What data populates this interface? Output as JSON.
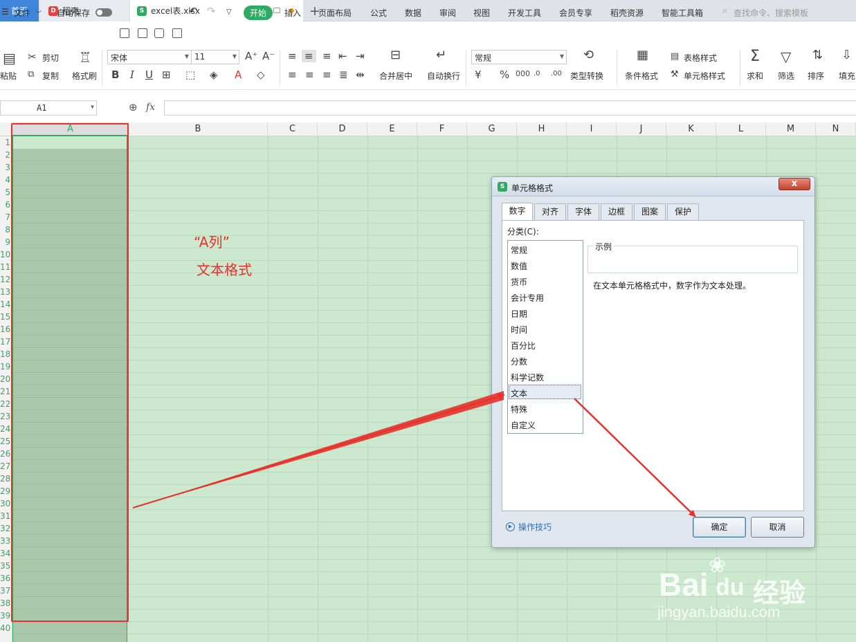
{
  "tabs": {
    "home": "首页",
    "daoke": "稻壳",
    "file": "excel表.xlsx",
    "plus": "+"
  },
  "menu": {
    "hamburger": "☰",
    "file": "文件",
    "autosave": "自动保存",
    "items": [
      "开始",
      "插入",
      "页面布局",
      "公式",
      "数据",
      "审阅",
      "视图",
      "开发工具",
      "会员专享",
      "稻壳资源",
      "智能工具箱"
    ],
    "search": "查找命令、搜索模板"
  },
  "ribbon": {
    "paste": "粘贴",
    "cut": "剪切",
    "copy": "复制",
    "format_painter": "格式刷",
    "font_name": "宋体",
    "font_size": "11",
    "merge": "合并居中",
    "wrap": "自动换行",
    "number_format": "常规",
    "type_convert": "类型转换",
    "cond_format": "条件格式",
    "table_style": "表格样式",
    "cell_style": "单元格样式",
    "sum": "求和",
    "filter": "筛选",
    "sort": "排序",
    "fill": "填充",
    "bold": "B",
    "italic": "I",
    "underline": "U",
    "percent": "%",
    "currency": "¥"
  },
  "formula_bar": {
    "name_box": "A1",
    "fx": "fx"
  },
  "columns": [
    "A",
    "B",
    "C",
    "D",
    "E",
    "F",
    "G",
    "H",
    "I",
    "J",
    "K",
    "L",
    "M",
    "N"
  ],
  "rows": [
    "1",
    "2",
    "3",
    "4",
    "5",
    "6",
    "7",
    "8",
    "9",
    "10",
    "11",
    "12",
    "13",
    "14",
    "15",
    "16",
    "17",
    "18",
    "19",
    "20",
    "21",
    "22",
    "23",
    "24",
    "25",
    "26",
    "27",
    "28",
    "29",
    "30",
    "31",
    "32",
    "33",
    "34",
    "35",
    "36",
    "37",
    "38",
    "39",
    "40"
  ],
  "annotation": {
    "line1": "“A列”",
    "line2": "文本格式",
    "color": "#e8302a"
  },
  "dialog": {
    "title": "单元格格式",
    "close": "x",
    "tabs": [
      "数字",
      "对齐",
      "字体",
      "边框",
      "图案",
      "保护"
    ],
    "category_label": "分类(C):",
    "categories": [
      "常规",
      "数值",
      "货币",
      "会计专用",
      "日期",
      "时间",
      "百分比",
      "分数",
      "科学记数",
      "文本",
      "特殊",
      "自定义"
    ],
    "selected_category": "文本",
    "sample_label": "示例",
    "description": "在文本单元格格式中，数字作为文本处理。",
    "tips": "操作技巧",
    "ok": "确定",
    "cancel": "取消"
  },
  "watermark": {
    "brand": "Bai",
    "paw": "du",
    "cn": "经验",
    "url": "jingyan.baidu.com"
  },
  "colors": {
    "accent": "#2eaa62",
    "tab_blue": "#3f86db",
    "grid_bg": "#cce8cf",
    "selection": "#a9c8ab",
    "annotation": "#e8302a"
  }
}
